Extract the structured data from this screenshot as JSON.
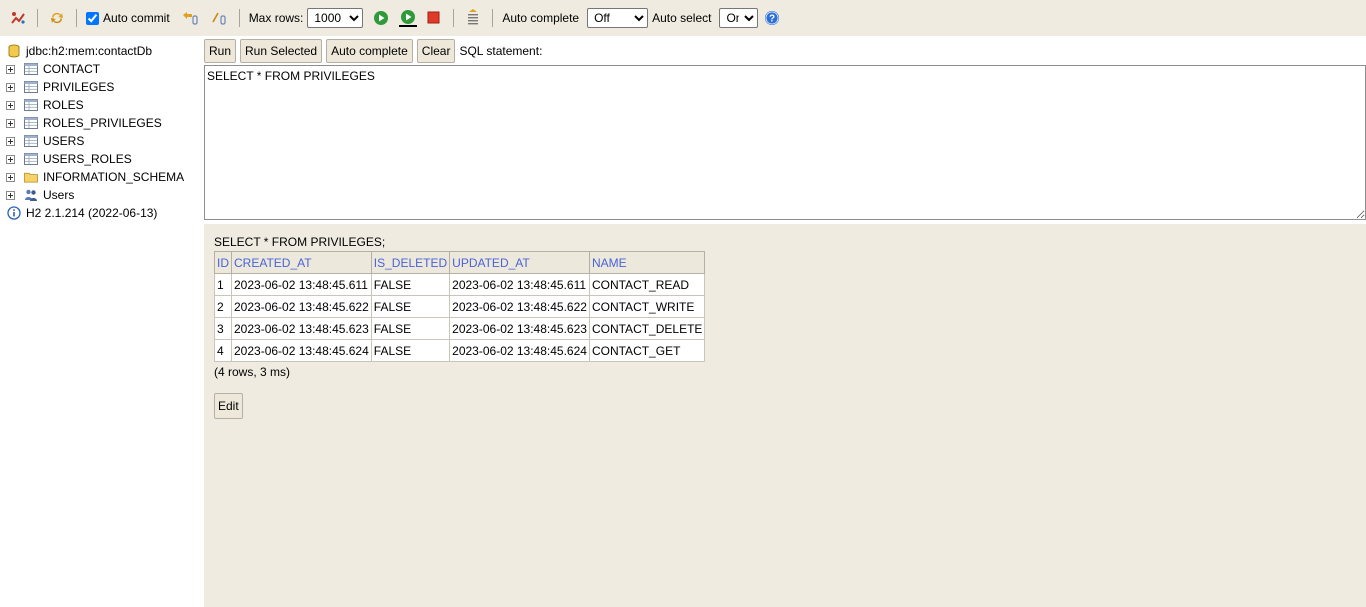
{
  "toolbar": {
    "auto_commit_label": "Auto commit",
    "auto_commit_checked": true,
    "max_rows_label": "Max rows:",
    "max_rows_value": "1000",
    "auto_complete_label": "Auto complete",
    "auto_complete_value": "Off",
    "auto_select_label": "Auto select",
    "auto_select_value": "On",
    "help_glyph": "?"
  },
  "sidebar": {
    "connection": "jdbc:h2:mem:contactDb",
    "tables": [
      "CONTACT",
      "PRIVILEGES",
      "ROLES",
      "ROLES_PRIVILEGES",
      "USERS",
      "USERS_ROLES"
    ],
    "schema": "INFORMATION_SCHEMA",
    "users": "Users",
    "version": "H2 2.1.214 (2022-06-13)"
  },
  "query": {
    "run_label": "Run",
    "run_selected_label": "Run Selected",
    "auto_complete_label": "Auto complete",
    "clear_label": "Clear",
    "sql_label": "SQL statement:",
    "sql_text": "SELECT * FROM PRIVILEGES"
  },
  "result": {
    "statement": "SELECT * FROM PRIVILEGES;",
    "columns": [
      "ID",
      "CREATED_AT",
      "IS_DELETED",
      "UPDATED_AT",
      "NAME"
    ],
    "rows": [
      [
        "1",
        "2023-06-02 13:48:45.611",
        "FALSE",
        "2023-06-02 13:48:45.611",
        "CONTACT_READ"
      ],
      [
        "2",
        "2023-06-02 13:48:45.622",
        "FALSE",
        "2023-06-02 13:48:45.622",
        "CONTACT_WRITE"
      ],
      [
        "3",
        "2023-06-02 13:48:45.623",
        "FALSE",
        "2023-06-02 13:48:45.623",
        "CONTACT_DELETE"
      ],
      [
        "4",
        "2023-06-02 13:48:45.624",
        "FALSE",
        "2023-06-02 13:48:45.624",
        "CONTACT_GET"
      ]
    ],
    "footer": "(4 rows, 3 ms)",
    "edit_label": "Edit"
  },
  "colors": {
    "background": "#efebe0",
    "header_text": "#4a63d8",
    "button_bg": "#ede8da"
  }
}
